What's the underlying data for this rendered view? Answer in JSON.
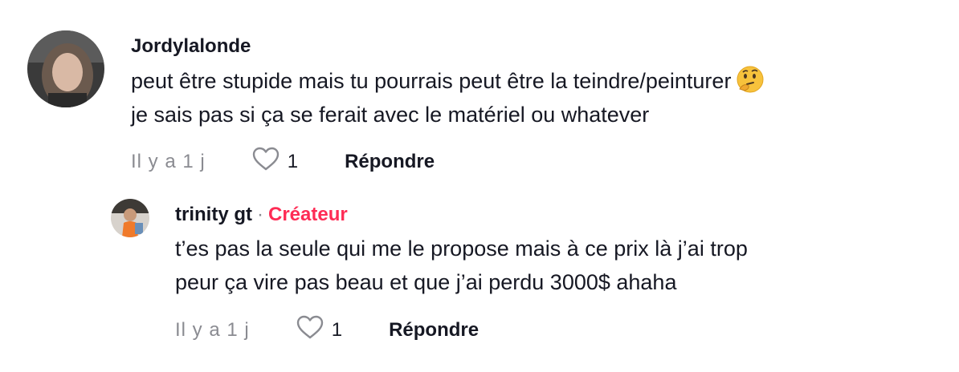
{
  "comment": {
    "username": "Jordylalonde",
    "text_line1": "peut être stupide mais tu pourrais peut être la teindre/peinturer",
    "emoji": "thinking-face-emoji",
    "text_line2": "je sais pas si ça se ferait avec le matériel ou whatever",
    "time": "Il y a 1 j",
    "likes": "1",
    "reply_label": "Répondre"
  },
  "reply": {
    "username": "trinity gt",
    "separator": "·",
    "badge": "Créateur",
    "text_line1": "t’es pas la seule qui me le propose mais à ce prix là j’ai trop",
    "text_line2": "peur ça vire pas beau et que j’ai perdu 3000$ ahaha",
    "time": "Il y a 1 j",
    "likes": "1",
    "reply_label": "Répondre"
  },
  "colors": {
    "creator_badge": "#fe2c55",
    "muted": "#8a8b91",
    "text": "#161823"
  }
}
